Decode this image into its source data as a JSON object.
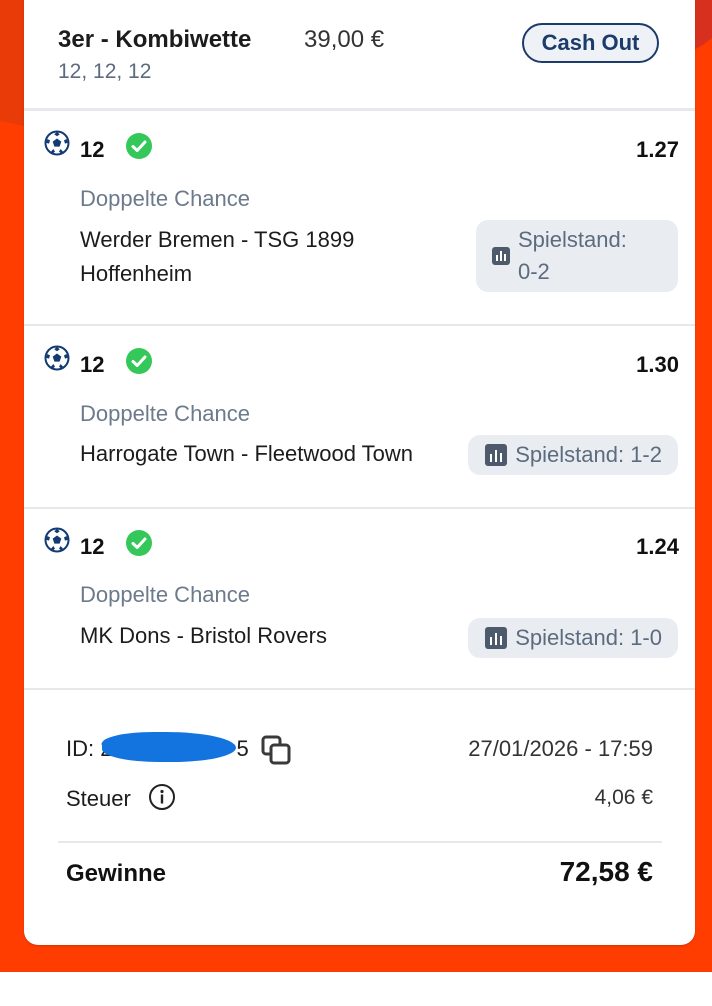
{
  "bet": {
    "title": "3er - Kombiwette",
    "stake": "39,00 €",
    "subtitle": "12, 12, 12",
    "cashout_label": "Cash Out"
  },
  "selections": [
    {
      "pick": "12",
      "odds": "1.27",
      "market": "Doppelte Chance",
      "event_line1": "Werder Bremen - TSG 1899",
      "event_line2": "Hoffenheim",
      "score_line1": "Spielstand:",
      "score_line2": "0-2"
    },
    {
      "pick": "12",
      "odds": "1.30",
      "market": "Doppelte Chance",
      "event": "Harrogate Town - Fleetwood Town",
      "score": "Spielstand: 1-2"
    },
    {
      "pick": "12",
      "odds": "1.24",
      "market": "Doppelte Chance",
      "event": "MK Dons - Bristol Rovers",
      "score": "Spielstand: 1-0"
    }
  ],
  "footer": {
    "id_label": "ID: 2",
    "id_tail": "5",
    "date": "27/01/2026 - 17:59",
    "tax_label": "Steuer",
    "tax_value": "4,06 €",
    "winnings_label": "Gewinne",
    "winnings_value": "72,58 €"
  },
  "colors": {
    "background": "#ff3d00",
    "accent": "#1c3b6b",
    "success": "#34c759",
    "muted": "#6c7a8c"
  },
  "icons": [
    "football-icon",
    "check-circle-icon",
    "stats-icon",
    "copy-icon",
    "info-icon"
  ]
}
